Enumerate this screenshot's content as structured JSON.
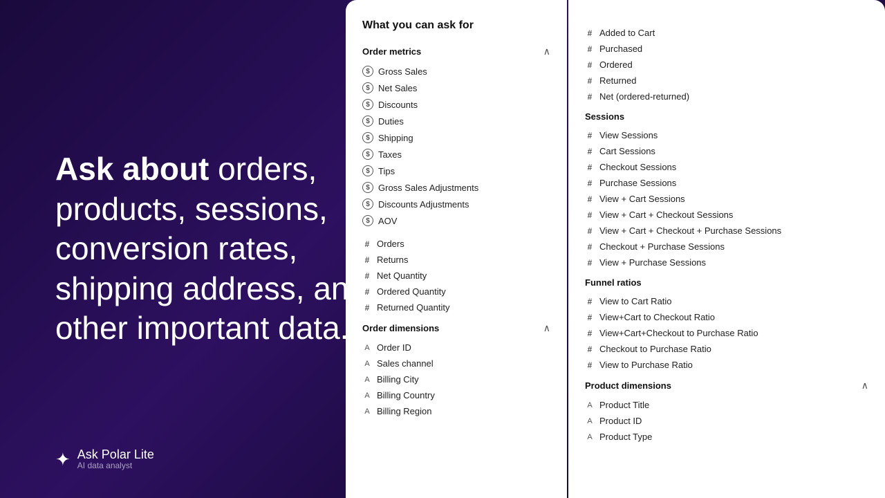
{
  "background": {
    "color": "#1a0a3c"
  },
  "hero": {
    "text_bold": "Ask about",
    "text_rest": " orders, products, sessions, conversion rates, shipping address, and other important data."
  },
  "brand": {
    "name": "Ask Polar",
    "name_suffix": "Lite",
    "subtitle": "AI data analyst",
    "icon": "✦"
  },
  "panel_title": "What you can ask for",
  "left_panel": {
    "sections": [
      {
        "id": "order_metrics",
        "label": "Order metrics",
        "collapsible": true,
        "collapsed": false,
        "icon_type": "dollar",
        "items": [
          "Gross Sales",
          "Net Sales",
          "Discounts",
          "Duties",
          "Shipping",
          "Taxes",
          "Tips",
          "Gross Sales Adjustments",
          "Discounts Adjustments",
          "AOV"
        ]
      },
      {
        "id": "order_counts",
        "label": "",
        "collapsible": false,
        "icon_type": "hash",
        "items": [
          "Orders",
          "Returns",
          "Net Quantity",
          "Ordered Quantity",
          "Returned Quantity"
        ]
      },
      {
        "id": "order_dimensions",
        "label": "Order dimensions",
        "collapsible": true,
        "collapsed": false,
        "icon_type": "a",
        "items": [
          "Order ID",
          "Sales channel",
          "Billing City",
          "Billing Country",
          "Billing Region"
        ]
      }
    ]
  },
  "right_panel": {
    "sections": [
      {
        "id": "quantity_metrics",
        "label": "",
        "collapsible": false,
        "icon_type": "hash",
        "items": [
          "Added to Cart",
          "Purchased",
          "Ordered",
          "Returned",
          "Net (ordered-returned)"
        ]
      },
      {
        "id": "sessions",
        "label": "Sessions",
        "collapsible": false,
        "icon_type": "hash",
        "items": [
          "View Sessions",
          "Cart Sessions",
          "Checkout Sessions",
          "Purchase Sessions",
          "View + Cart Sessions",
          "View + Cart + Checkout Sessions",
          "View + Cart + Checkout + Purchase Sessions",
          "Checkout + Purchase Sessions",
          "View + Purchase Sessions"
        ]
      },
      {
        "id": "funnel_ratios",
        "label": "Funnel ratios",
        "collapsible": false,
        "icon_type": "hash",
        "items": [
          "View to Cart Ratio",
          "View+Cart to Checkout Ratio",
          "View+Cart+Checkout to Purchase Ratio",
          "Checkout to Purchase Ratio",
          "View to Purchase Ratio"
        ]
      },
      {
        "id": "product_dimensions",
        "label": "Product dimensions",
        "collapsible": true,
        "collapsed": false,
        "icon_type": "a",
        "items": [
          "Product Title",
          "Product ID",
          "Product Type"
        ]
      }
    ]
  },
  "icons": {
    "dollar": "$",
    "hash": "#",
    "a": "A",
    "chevron_up": "^",
    "star": "✦"
  }
}
